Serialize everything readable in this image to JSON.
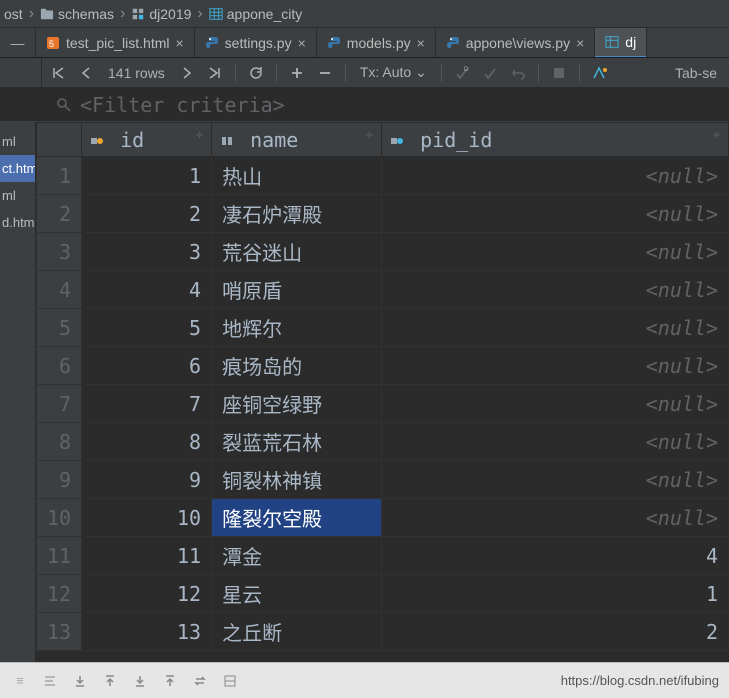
{
  "breadcrumb": {
    "items": [
      {
        "label": "ost"
      },
      {
        "label": "schemas"
      },
      {
        "label": "dj2019"
      },
      {
        "label": "appone_city"
      }
    ]
  },
  "tabs": [
    {
      "label": "test_pic_list.html",
      "icon": "html",
      "active": false
    },
    {
      "label": "settings.py",
      "icon": "python",
      "active": false
    },
    {
      "label": "models.py",
      "icon": "python",
      "active": false
    },
    {
      "label": "appone\\views.py",
      "icon": "python",
      "active": false
    },
    {
      "label": "dj",
      "icon": "table",
      "active": true
    }
  ],
  "toolbar": {
    "rows_label": "141 rows",
    "tx_label": "Tx: Auto",
    "tab_label": "Tab-se"
  },
  "filter": {
    "placeholder": "<Filter criteria>"
  },
  "sidebar": {
    "items": [
      {
        "label": "ml",
        "selected": false
      },
      {
        "label": "ct.htm",
        "selected": true
      },
      {
        "label": "ml",
        "selected": false
      },
      {
        "label": "d.html",
        "selected": false
      }
    ]
  },
  "table": {
    "columns": [
      {
        "key": "id",
        "label": "id"
      },
      {
        "key": "name",
        "label": "name"
      },
      {
        "key": "pid_id",
        "label": "pid_id"
      }
    ],
    "rows": [
      {
        "n": "1",
        "id": "1",
        "name": "热山",
        "pid": "<null>",
        "null": true
      },
      {
        "n": "2",
        "id": "2",
        "name": "凄石炉潭殿",
        "pid": "<null>",
        "null": true
      },
      {
        "n": "3",
        "id": "3",
        "name": "荒谷迷山",
        "pid": "<null>",
        "null": true
      },
      {
        "n": "4",
        "id": "4",
        "name": "哨原盾",
        "pid": "<null>",
        "null": true
      },
      {
        "n": "5",
        "id": "5",
        "name": "地辉尔",
        "pid": "<null>",
        "null": true
      },
      {
        "n": "6",
        "id": "6",
        "name": "痕场岛的",
        "pid": "<null>",
        "null": true
      },
      {
        "n": "7",
        "id": "7",
        "name": "座铜空绿野",
        "pid": "<null>",
        "null": true
      },
      {
        "n": "8",
        "id": "8",
        "name": "裂蓝荒石林",
        "pid": "<null>",
        "null": true
      },
      {
        "n": "9",
        "id": "9",
        "name": "铜裂林神镇",
        "pid": "<null>",
        "null": true
      },
      {
        "n": "10",
        "id": "10",
        "name": "隆裂尔空殿",
        "pid": "<null>",
        "null": true,
        "selected": true
      },
      {
        "n": "11",
        "id": "11",
        "name": "潭金",
        "pid": "4",
        "null": false
      },
      {
        "n": "12",
        "id": "12",
        "name": "星云",
        "pid": "1",
        "null": false
      },
      {
        "n": "13",
        "id": "13",
        "name": "之丘断",
        "pid": "2",
        "null": false
      }
    ]
  },
  "status": {
    "watermark": "https://blog.csdn.net/ifubing"
  }
}
